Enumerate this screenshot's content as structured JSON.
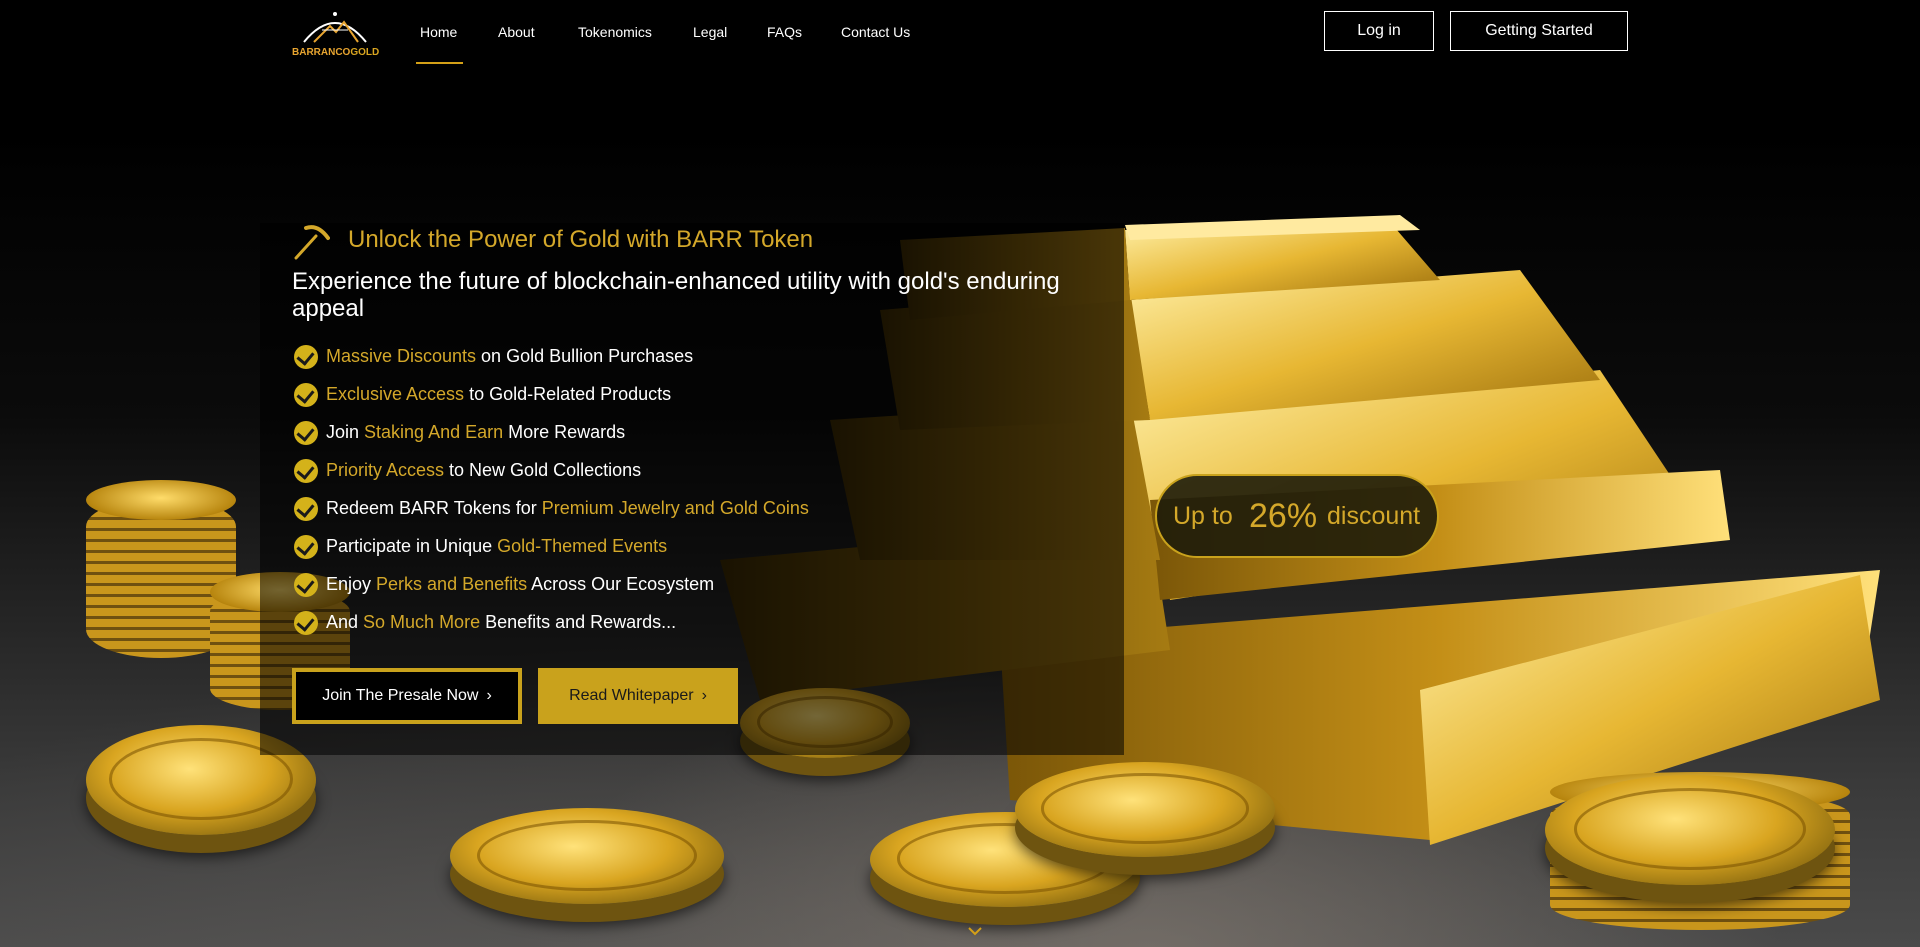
{
  "brand": {
    "logo_text_part1": "BARRANCO",
    "logo_text_part2": "GOLD"
  },
  "nav": {
    "items": [
      {
        "label": "Home"
      },
      {
        "label": "About"
      },
      {
        "label": "Tokenomics"
      },
      {
        "label": "Legal"
      },
      {
        "label": "FAQs"
      },
      {
        "label": "Contact Us"
      }
    ],
    "active": "Home"
  },
  "header": {
    "login_label": "Log in",
    "getting_started_label": "Getting Started"
  },
  "hero": {
    "headline": "Unlock the Power of Gold with BARR Token",
    "subheadline": "Experience the future of blockchain-enhanced utility with gold's enduring appeal",
    "features": [
      {
        "pre": "",
        "highlight": "Massive Discounts",
        "post": " on Gold Bullion Purchases"
      },
      {
        "pre": "",
        "highlight": "Exclusive Access",
        "post": " to Gold-Related Products"
      },
      {
        "pre": "Join ",
        "highlight": "Staking And Earn",
        "post": " More Rewards"
      },
      {
        "pre": "",
        "highlight": "Priority Access",
        "post": " to New Gold Collections"
      },
      {
        "pre": "Redeem BARR Tokens for ",
        "highlight": "Premium Jewelry and Gold Coins",
        "post": ""
      },
      {
        "pre": "Participate in Unique ",
        "highlight": "Gold-Themed Events",
        "post": ""
      },
      {
        "pre": "Enjoy ",
        "highlight": "Perks and Benefits",
        "post": " Across Our Ecosystem"
      },
      {
        "pre": "And ",
        "highlight": "So Much More",
        "post": " Benefits and Rewards..."
      }
    ],
    "cta_primary": "Join The Presale Now",
    "cta_secondary": "Read Whitepaper"
  },
  "discount": {
    "prefix": "Up to",
    "value": "26%",
    "suffix": "discount"
  },
  "icons": {
    "pickaxe": "pickaxe-icon",
    "check": "check-circle-icon",
    "chevron_right": "chevron-right-icon",
    "scroll_down": "chevron-down-icon"
  },
  "colors": {
    "gold": "#d4a82a",
    "button_gold": "#c9a21c",
    "background": "#000000"
  }
}
